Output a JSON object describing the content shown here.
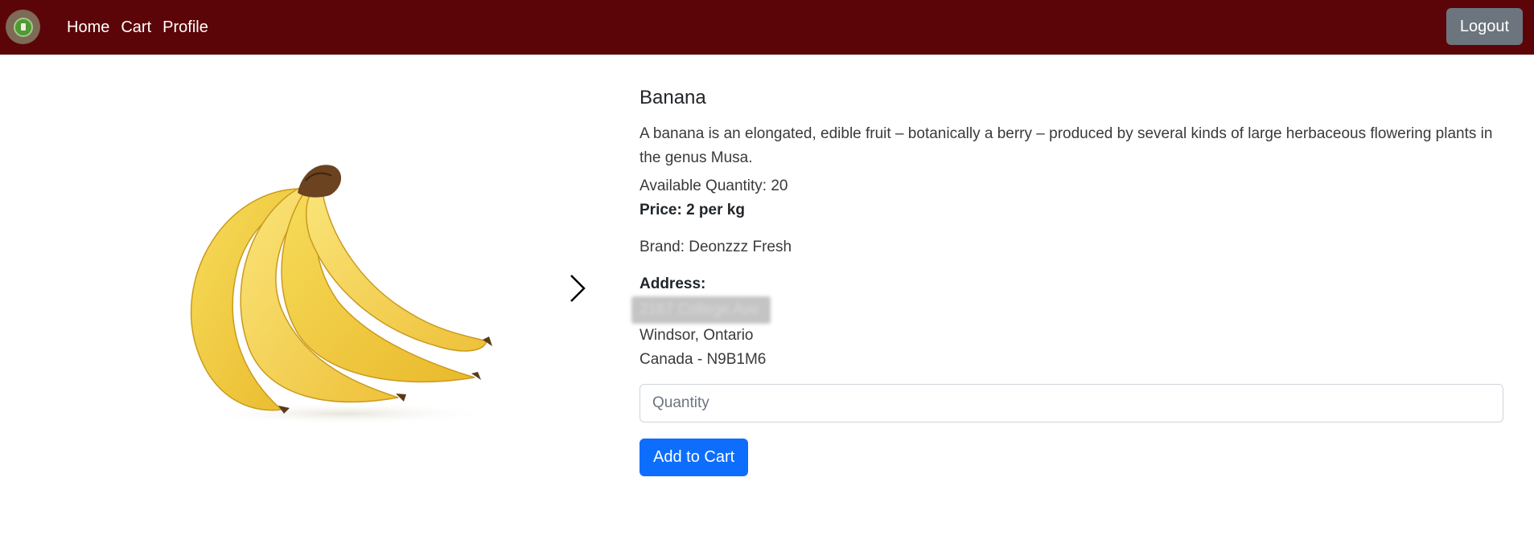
{
  "navbar": {
    "logo_icon": "store-logo-icon",
    "links": [
      "Home",
      "Cart",
      "Profile"
    ],
    "logout_label": "Logout",
    "background": "#5c0508"
  },
  "product": {
    "image_icon": "banana-bunch-image",
    "carousel_next_icon": "chevron-right-icon",
    "title": "Banana",
    "description": "A banana is an elongated, edible fruit – botanically a berry – produced by several kinds of large herbaceous flowering plants in the genus Musa.",
    "available_quantity": "Available Quantity: 20",
    "price": "Price: 2 per kg",
    "brand": "Brand: Deonzzz Fresh",
    "address_label": "Address:",
    "address_line1": "2167 College Ave",
    "address_line2": "Windsor, Ontario",
    "address_line3": "Canada - N9B1M6"
  },
  "form": {
    "quantity_placeholder": "Quantity",
    "quantity_value": "",
    "add_to_cart_label": "Add to Cart"
  },
  "colors": {
    "primary_button": "#0d6efd",
    "secondary_button": "#6c757d"
  }
}
